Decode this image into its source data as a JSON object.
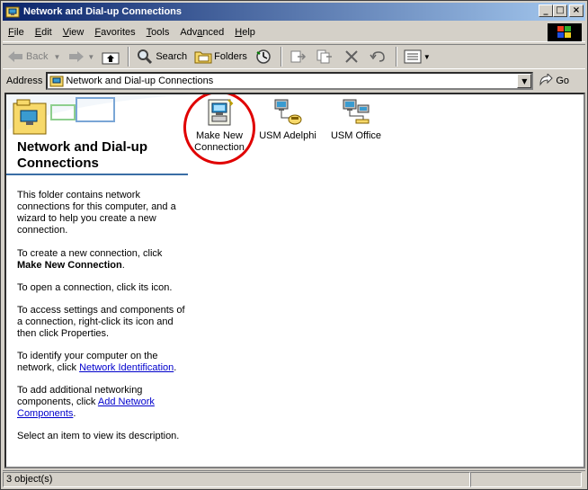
{
  "window": {
    "title": "Network and Dial-up Connections",
    "minimize": "_",
    "maximize": "□",
    "close": "×"
  },
  "menu": {
    "items": [
      {
        "underline": "F",
        "rest": "ile"
      },
      {
        "underline": "E",
        "rest": "dit"
      },
      {
        "underline": "V",
        "rest": "iew"
      },
      {
        "underline": "F",
        "rest": "avorites",
        "prefix": ""
      },
      {
        "underline": "T",
        "rest": "ools"
      },
      {
        "prefix": "Adv",
        "underline": "a",
        "rest": "nced"
      },
      {
        "underline": "H",
        "rest": "elp"
      }
    ]
  },
  "toolbar": {
    "back": "Back",
    "search": "Search",
    "folders": "Folders"
  },
  "address": {
    "label": "Address",
    "value": "Network and Dial-up Connections",
    "go": "Go"
  },
  "left_pane": {
    "title": "Network and Dial-up Connections",
    "p1": "This folder contains network connections for this computer, and a wizard to help you create a new connection.",
    "p2_pre": "To create a new connection, click",
    "p2_bold": "Make New Connection",
    "p2_post": ".",
    "p3": "To open a connection, click its icon.",
    "p4": "To access settings and components of a connection, right-click its icon and then click Properties.",
    "p5_pre": "To identify your computer on the network, click",
    "p5_link": "Network Identification",
    "p5_post": ".",
    "p6_pre": "To add additional networking components, click",
    "p6_link": "Add Network Components",
    "p6_post": ".",
    "p7": "Select an item to view its description."
  },
  "items": [
    {
      "label_line1": "Make New",
      "label_line2": "Connection"
    },
    {
      "label_line1": "USM Adelphi"
    },
    {
      "label_line1": "USM Office"
    }
  ],
  "status": {
    "count": "3 object(s)"
  },
  "colors": {
    "titlebar_start": "#0a246a",
    "titlebar_end": "#a6caf0",
    "highlight_circle": "#e00000",
    "link": "#0000cc"
  }
}
